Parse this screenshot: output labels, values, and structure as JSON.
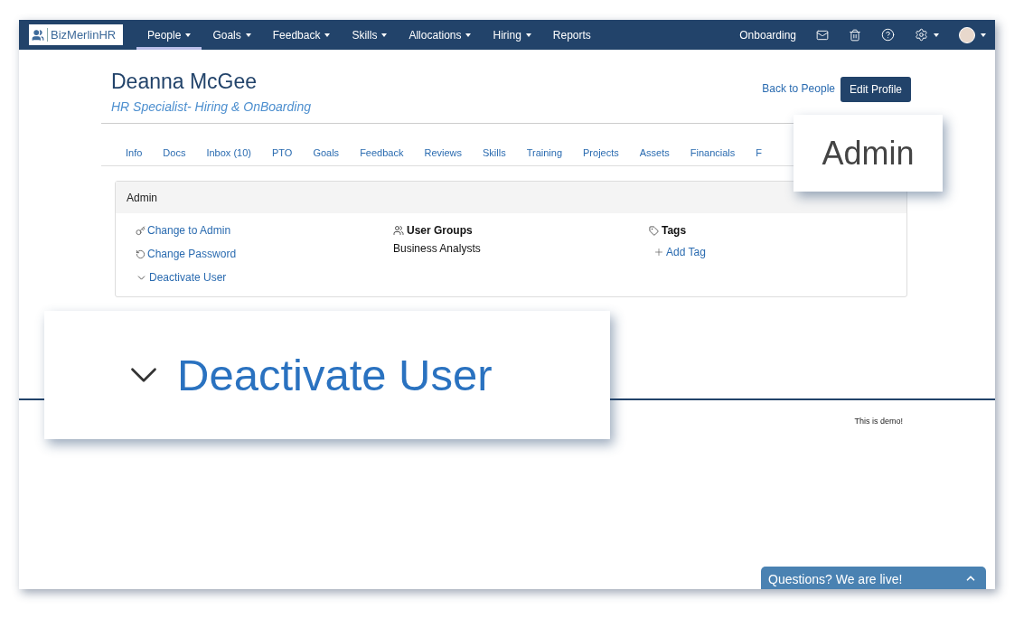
{
  "navbar": {
    "logo": "BizMerlinHR",
    "menu": [
      {
        "label": "People",
        "dropdown": true,
        "selected": true
      },
      {
        "label": "Goals",
        "dropdown": true,
        "selected": false
      },
      {
        "label": "Feedback",
        "dropdown": true,
        "selected": false
      },
      {
        "label": "Skills",
        "dropdown": true,
        "selected": false
      },
      {
        "label": "Allocations",
        "dropdown": true,
        "selected": false
      },
      {
        "label": "Hiring",
        "dropdown": true,
        "selected": false
      },
      {
        "label": "Reports",
        "dropdown": false,
        "selected": false
      }
    ],
    "right_link": "Onboarding"
  },
  "profile": {
    "name": "Deanna McGee",
    "job_title": "HR Specialist- Hiring & OnBoarding",
    "back_link": "Back to People",
    "edit_button": "Edit Profile"
  },
  "tabs": [
    {
      "label": "Info",
      "selected": false
    },
    {
      "label": "Docs",
      "selected": false
    },
    {
      "label": "Inbox (10)",
      "selected": false
    },
    {
      "label": "PTO",
      "selected": false
    },
    {
      "label": "Goals",
      "selected": false
    },
    {
      "label": "Feedback",
      "selected": false
    },
    {
      "label": "Reviews",
      "selected": false
    },
    {
      "label": "Skills",
      "selected": false
    },
    {
      "label": "Training",
      "selected": false
    },
    {
      "label": "Projects",
      "selected": false
    },
    {
      "label": "Assets",
      "selected": false
    },
    {
      "label": "Financials",
      "selected": false
    },
    {
      "label": "F",
      "selected": false
    }
  ],
  "admin_panel": {
    "title": "Admin",
    "actions": [
      {
        "kind": "key",
        "label": "Change to Admin"
      },
      {
        "kind": "reset",
        "label": "Change Password"
      },
      {
        "kind": "deactivate",
        "label": "Deactivate User"
      }
    ],
    "user_groups": {
      "title": "User Groups",
      "items": [
        "Business Analysts"
      ]
    },
    "tags": {
      "title": "Tags",
      "add": "Add Tag"
    }
  },
  "footer_note": "This is demo!",
  "chat": {
    "label": "Questions? We are live!"
  },
  "callouts": [
    {
      "kind": "heading",
      "text": "Admin"
    },
    {
      "kind": "chevron-link",
      "text": "Deactivate User"
    }
  ]
}
